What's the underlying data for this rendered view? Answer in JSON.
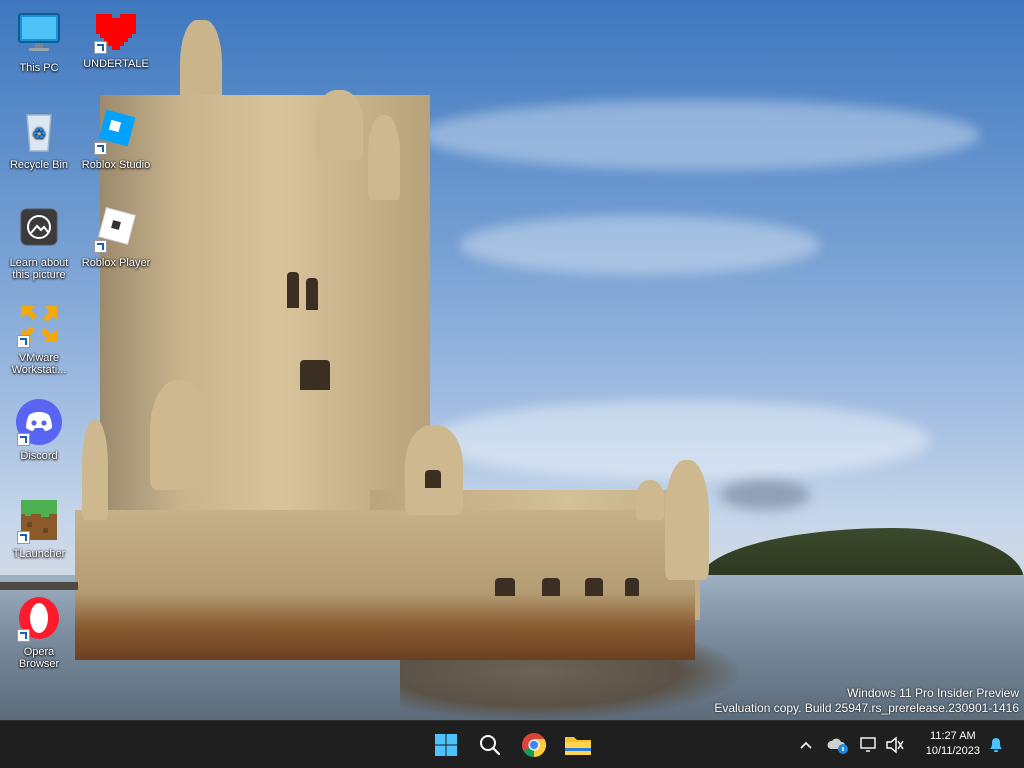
{
  "desktop": {
    "icons": [
      {
        "label": "This PC",
        "icon": "monitor-icon"
      },
      {
        "label": "UNDERTALE",
        "icon": "heart-icon"
      },
      {
        "label": "Recycle Bin",
        "icon": "recycle-bin-icon"
      },
      {
        "label": "Roblox Studio",
        "icon": "roblox-studio-icon"
      },
      {
        "label": "Learn about this picture",
        "icon": "learn-picture-icon"
      },
      {
        "label": "Roblox Player",
        "icon": "roblox-player-icon"
      },
      {
        "label": "VMware Workstati...",
        "icon": "vmware-icon"
      },
      {
        "label": "Discord",
        "icon": "discord-icon"
      },
      {
        "label": "TLauncher",
        "icon": "minecraft-block-icon"
      },
      {
        "label": "Opera Browser",
        "icon": "opera-icon"
      }
    ]
  },
  "watermark": {
    "line1": "Windows 11 Pro Insider Preview",
    "line2": "Evaluation copy. Build 25947.rs_prerelease.230901-1416"
  },
  "taskbar": {
    "apps": [
      {
        "name": "Start",
        "icon": "windows-logo-icon"
      },
      {
        "name": "Search",
        "icon": "search-icon"
      },
      {
        "name": "Google Chrome",
        "icon": "chrome-icon"
      },
      {
        "name": "File Explorer",
        "icon": "folder-icon"
      }
    ],
    "tray": {
      "time": "11:27 AM",
      "date": "10/11/2023"
    }
  },
  "colors": {
    "taskbar_bg": "#1f1f1f",
    "accent": "#4cc2ff"
  }
}
